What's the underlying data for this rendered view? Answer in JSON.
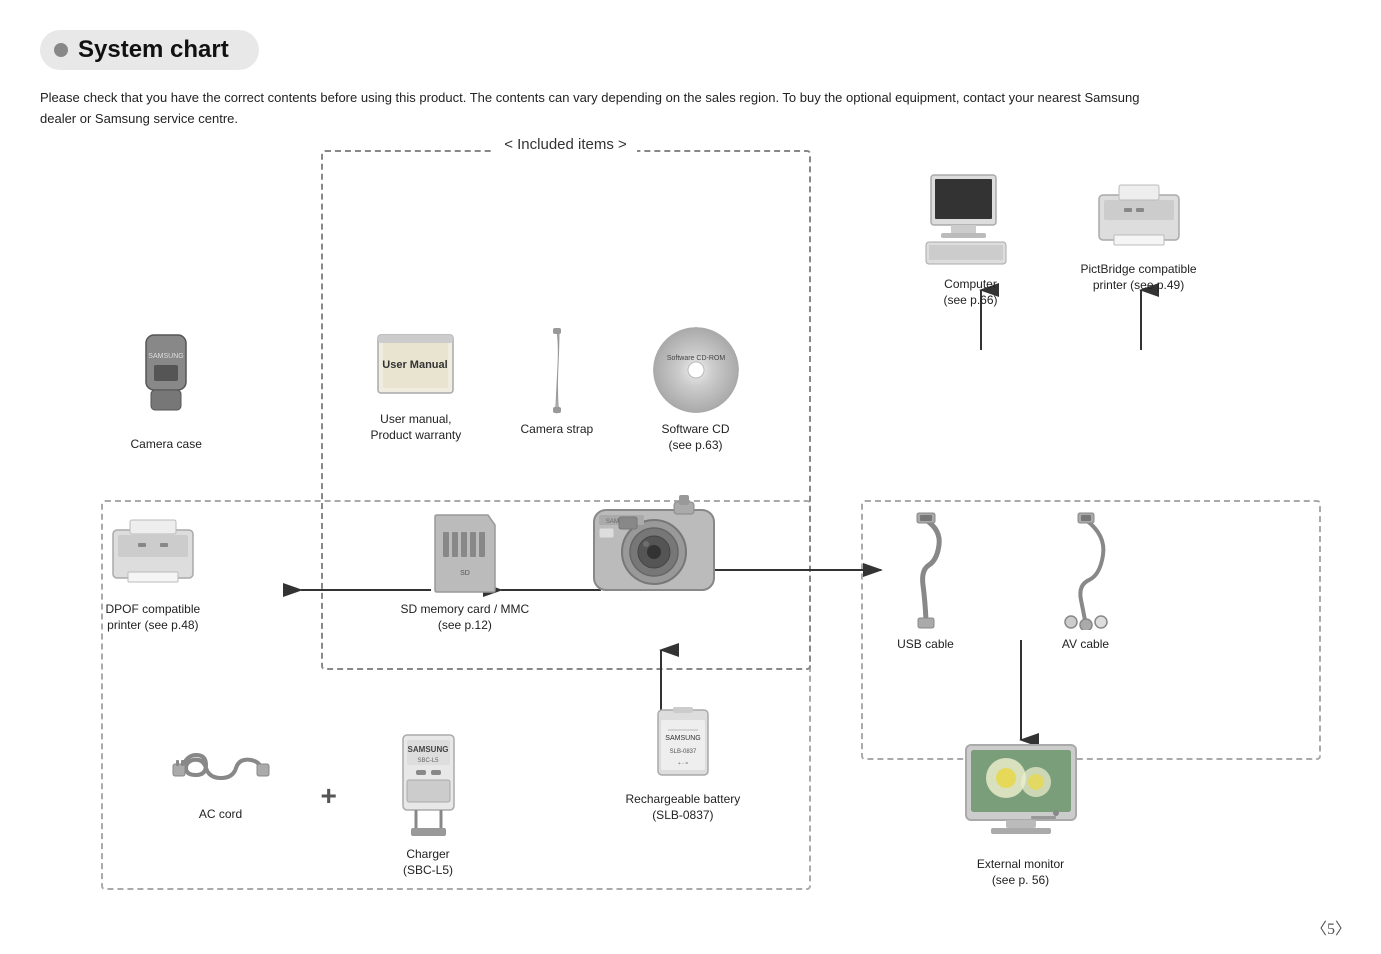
{
  "header": {
    "title": "System chart",
    "dot_color": "#888"
  },
  "description": "Please check that you have the correct contents before using this product. The contents can vary depending on the sales region. To buy the optional equipment, contact your nearest Samsung dealer or Samsung service centre.",
  "included_label": "< Included items >",
  "items": {
    "camera_case": {
      "label": "Camera case"
    },
    "user_manual": {
      "label": "User manual,\nProduct warranty"
    },
    "camera_strap": {
      "label": "Camera strap"
    },
    "software_cd": {
      "label": "Software CD\n(see p.63)"
    },
    "computer": {
      "label": "Computer\n(see p.66)"
    },
    "pictbridge_printer": {
      "label": "PictBridge compatible\nprinter (see p.49)"
    },
    "dpof_printer": {
      "label": "DPOF compatible\nprinter (see p.48)"
    },
    "sd_card": {
      "label": "SD memory card / MMC\n(see p.12)"
    },
    "usb_cable": {
      "label": "USB cable"
    },
    "av_cable": {
      "label": "AV cable"
    },
    "battery": {
      "label": "Rechargeable battery\n(SLB-0837)"
    },
    "ac_cord": {
      "label": "AC cord"
    },
    "charger": {
      "label": "Charger\n(SBC-L5)"
    },
    "monitor": {
      "label": "External monitor\n(see p. 56)"
    }
  },
  "page_number": "〈5〉"
}
